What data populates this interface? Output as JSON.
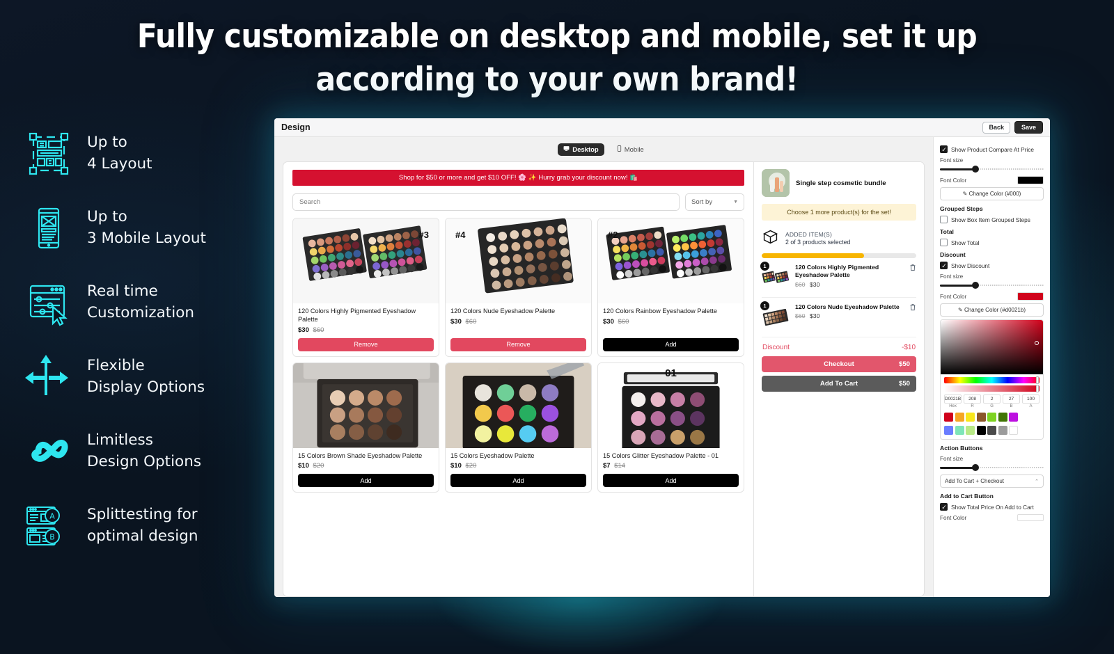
{
  "headline": "Fully customizable on desktop and mobile, set it up according to your own brand!",
  "features": [
    {
      "icon": "layout-grid-icon",
      "line1": "Up to",
      "line2": "4 Layout"
    },
    {
      "icon": "mobile-layout-icon",
      "line1": "Up to",
      "line2": "3 Mobile Layout"
    },
    {
      "icon": "sliders-cursor-icon",
      "line1": "Real time",
      "line2": "Customization"
    },
    {
      "icon": "arrows-directions-icon",
      "line1": "Flexible",
      "line2": "Display Options"
    },
    {
      "icon": "infinity-icon",
      "line1": "Limitless",
      "line2": "Design Options"
    },
    {
      "icon": "split-test-ab-icon",
      "line1": "Splittesting for",
      "line2": "optimal design"
    }
  ],
  "app": {
    "title": "Design",
    "back_label": "Back",
    "save_label": "Save",
    "device_tabs": [
      {
        "label": "Desktop",
        "icon": "desktop-icon",
        "active": true
      },
      {
        "label": "Mobile",
        "icon": "mobile-icon",
        "active": false
      }
    ],
    "promo_banner": "Shop for $50 or more and get $10 OFF! 🌸 ✨ Hurry grab your discount now! 🛍️",
    "search_placeholder": "Search",
    "sort_label": "Sort by",
    "products": [
      {
        "badge": "#3",
        "badge_pos": "right",
        "name": "120 Colors Highly Pigmented Eyeshadow Palette",
        "price": "$30",
        "compare": "$60",
        "action": "Remove",
        "action_style": "remove"
      },
      {
        "badge": "#4",
        "badge_pos": "left",
        "name": "120 Colors Nude Eyeshadow Palette",
        "price": "$30",
        "compare": "$60",
        "action": "Remove",
        "action_style": "remove"
      },
      {
        "badge": "#2",
        "badge_pos": "left",
        "name": "120 Colors Rainbow Eyeshadow Palette",
        "price": "$30",
        "compare": "$60",
        "action": "Add",
        "action_style": "add"
      },
      {
        "badge": "",
        "badge_pos": "none",
        "name": "15 Colors Brown Shade Eyeshadow Palette",
        "price": "$10",
        "compare": "$20",
        "action": "Add",
        "action_style": "add"
      },
      {
        "badge": "",
        "badge_pos": "none",
        "name": "15 Colors Eyeshadow Palette",
        "price": "$10",
        "compare": "$20",
        "action": "Add",
        "action_style": "add"
      },
      {
        "badge": "01",
        "badge_pos": "center",
        "name": "15 Colors Glitter Eyeshadow Palette - 01",
        "price": "$7",
        "compare": "$14",
        "action": "Add",
        "action_style": "add"
      }
    ],
    "cart": {
      "bundle_title": "Single step cosmetic bundle",
      "choose_note": "Choose 1 more product(s) for the set!",
      "added_label": "ADDED ITEM(S)",
      "added_sub": "2 of 3 products selected",
      "progress_percent": 66,
      "items": [
        {
          "qty": "1",
          "name": "120 Colors Highly Pigmented Eyeshadow Palette",
          "old_price": "$60",
          "new_price": "$30",
          "delete_icon": "trash-icon"
        },
        {
          "qty": "1",
          "name": "120 Colors Nude Eyeshadow Palette",
          "old_price": "$60",
          "new_price": "$30",
          "delete_icon": "trash-icon"
        }
      ],
      "discount_label": "Discount",
      "discount_value": "-$10",
      "checkout_label": "Checkout",
      "checkout_amount": "$50",
      "addcart_label": "Add To Cart",
      "addcart_amount": "$50"
    }
  },
  "settings": {
    "show_compare_label": "Show Product Compare At Price",
    "show_compare_checked": true,
    "font_size_label": "Font size",
    "font_color_label": "Font Color",
    "compare_color_hex": "#000000",
    "compare_change_label": "Change Color (#000)",
    "grouped_steps_head": "Grouped Steps",
    "grouped_steps_label": "Show Box Item Grouped Steps",
    "grouped_steps_checked": false,
    "total_head": "Total",
    "total_label": "Show Total",
    "total_checked": false,
    "discount_head": "Discount",
    "discount_label": "Show Discount",
    "discount_checked": true,
    "discount_color_hex": "#d0021b",
    "discount_change_label": "Change Color (#d0021b)",
    "picker": {
      "hex_value": "D0021B",
      "r": "208",
      "g": "2",
      "b": "27",
      "a": "100",
      "hex_label": "Hex",
      "r_label": "R",
      "g_label": "G",
      "b_label": "B",
      "a_label": "A",
      "swatches_row1": [
        "#d0021b",
        "#f5a623",
        "#f8e71c",
        "#8b572a",
        "#7ed321",
        "#417505",
        "#bd10e0"
      ],
      "swatches_row2": [
        "#6a7dff",
        "#7ee5b8",
        "#b8e986",
        "#000000",
        "#4a4a4a",
        "#9b9b9b",
        "#ffffff"
      ]
    },
    "action_buttons_head": "Action Buttons",
    "action_select_value": "Add To Cart + Checkout",
    "addcart_head": "Add to Cart Button",
    "show_total_price_label": "Show Total Price On Add to Cart",
    "show_total_price_checked": true,
    "bottom_font_color_label": "Font Color"
  }
}
